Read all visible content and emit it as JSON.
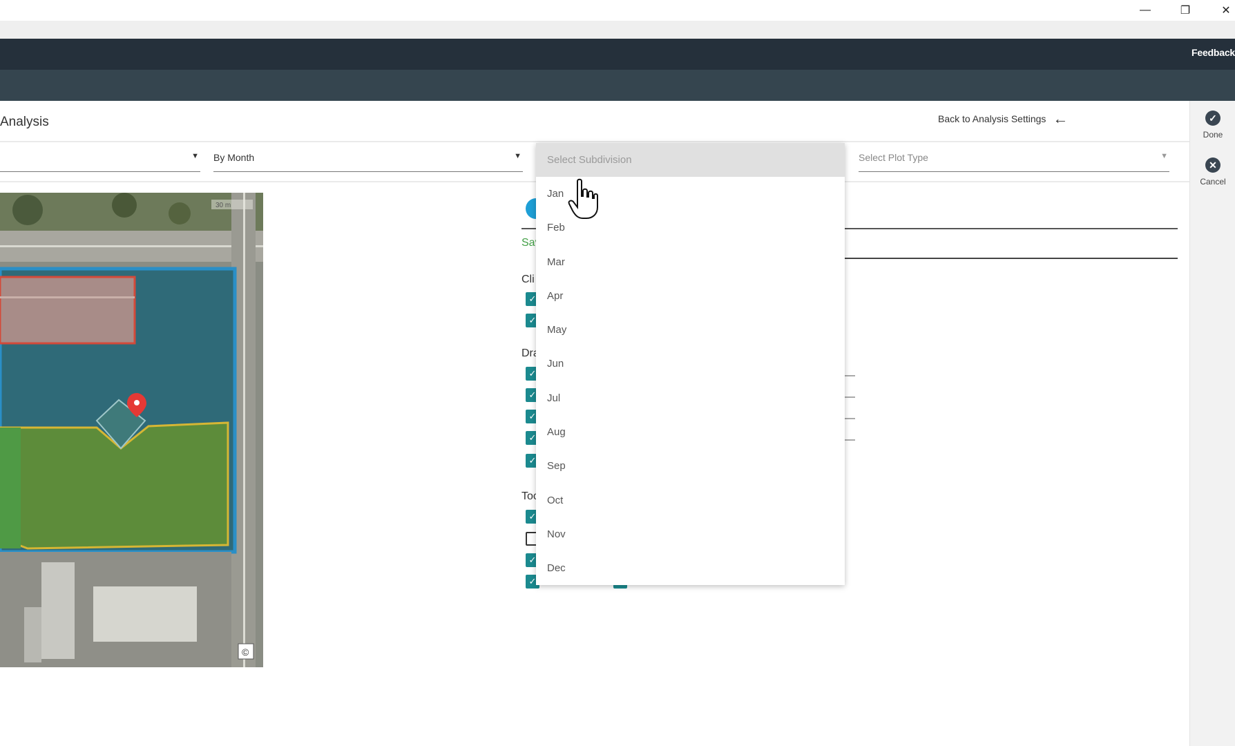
{
  "window": {
    "minimize_icon": "—",
    "restore_icon": "❐",
    "close_icon": "✕"
  },
  "header": {
    "feedback": "Feedback"
  },
  "sidebar_actions": {
    "done": {
      "label": "Done",
      "icon": "check-circle-icon"
    },
    "cancel": {
      "label": "Cancel",
      "icon": "x-circle-icon"
    }
  },
  "page": {
    "title": "Analysis",
    "back_link": "Back to Analysis Settings"
  },
  "filters": {
    "first": {
      "value": ""
    },
    "period": {
      "value": "By Month"
    },
    "subdivision": {
      "placeholder": "Select Subdivision",
      "options": [
        "Jan",
        "Feb",
        "Mar",
        "Apr",
        "May",
        "Jun",
        "Jul",
        "Aug",
        "Sep",
        "Oct",
        "Nov",
        "Dec"
      ]
    },
    "plot_type": {
      "placeholder": "Select Plot Type"
    }
  },
  "middle": {
    "save_partial": "Sav",
    "section_clim": "Cli",
    "section_dra": "Dra",
    "section_too": "Toc",
    "checkbox_states": [
      true,
      true,
      true,
      true,
      true,
      true,
      true,
      true,
      false,
      true,
      true,
      true
    ]
  },
  "map": {
    "scale_label": "30 m",
    "copyright": "©"
  },
  "colors": {
    "topbar": "#25303b",
    "subbar": "#35454f",
    "checkbox": "#1b8a8f",
    "save_green": "#43a047"
  }
}
